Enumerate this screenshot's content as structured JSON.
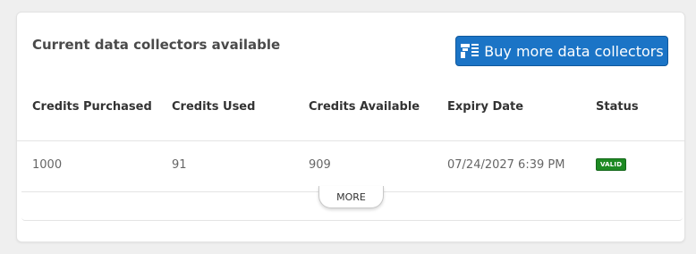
{
  "card": {
    "title": "Current data collectors available",
    "buy_button": {
      "label": "Buy more data collectors",
      "icon": "data-collector-icon",
      "color": "#1b74c6"
    }
  },
  "table": {
    "headers": [
      "Credits Purchased",
      "Credits Used",
      "Credits Available",
      "Expiry Date",
      "Status"
    ],
    "rows": [
      {
        "credits_purchased": "1000",
        "credits_used": "91",
        "credits_available": "909",
        "expiry_date": "07/24/2027 6:39 PM",
        "status": "VALID",
        "status_color": "#1d8a23"
      }
    ]
  },
  "more_button": {
    "label": "MORE"
  }
}
